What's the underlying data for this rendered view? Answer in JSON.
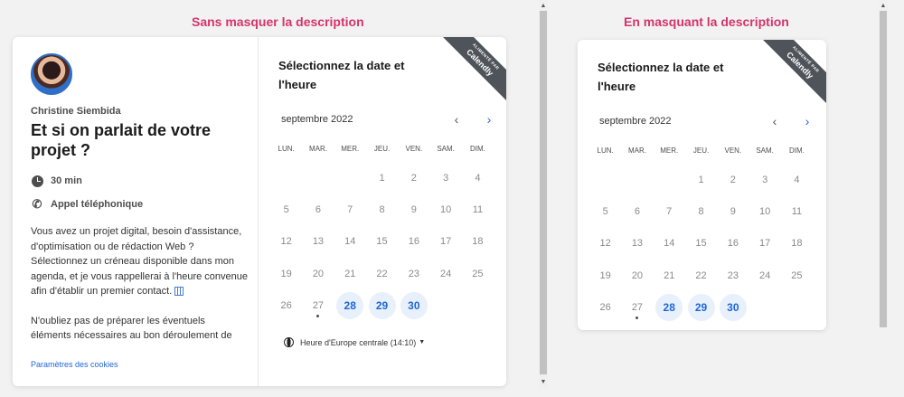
{
  "captions": {
    "left": "Sans masquer la description",
    "right": "En masquant la description"
  },
  "event": {
    "host": "Christine Siembida",
    "title": "Et si on parlait de votre projet ?",
    "duration": "30 min",
    "location": "Appel téléphonique",
    "description_p1": "Vous avez un projet digital, besoin d'assistance, d'optimisation ou de rédaction Web ? Sélectionnez un créneau disponible dans mon agenda, et je vous rappellerai à l'heure convenue afin d'établir un premier contact.",
    "description_p2": "N'oubliez pas de préparer les éventuels éléments nécessaires au bon déroulement de",
    "cookies_link": "Paramètres des cookies"
  },
  "calendar": {
    "heading": "Sélectionnez la date et l'heure",
    "month": "septembre 2022",
    "weekdays": [
      "LUN.",
      "MAR.",
      "MER.",
      "JEU.",
      "VEN.",
      "SAM.",
      "DIM."
    ],
    "days": [
      "",
      "",
      "",
      "1",
      "2",
      "3",
      "4",
      "5",
      "6",
      "7",
      "8",
      "9",
      "10",
      "11",
      "12",
      "13",
      "14",
      "15",
      "16",
      "17",
      "18",
      "19",
      "20",
      "21",
      "22",
      "23",
      "24",
      "25",
      "26",
      "27",
      "28",
      "29",
      "30"
    ],
    "available": [
      "28",
      "29",
      "30"
    ],
    "today": "27",
    "timezone": "Heure d'Europe centrale (14:10)"
  },
  "ribbon": {
    "small": "ALIMENTÉ PAR",
    "brand": "Calendly"
  },
  "colors": {
    "caption": "#d6336c",
    "accent": "#1f67d6",
    "available_bg": "#e8f0fc",
    "ribbon": "#4e5459"
  }
}
